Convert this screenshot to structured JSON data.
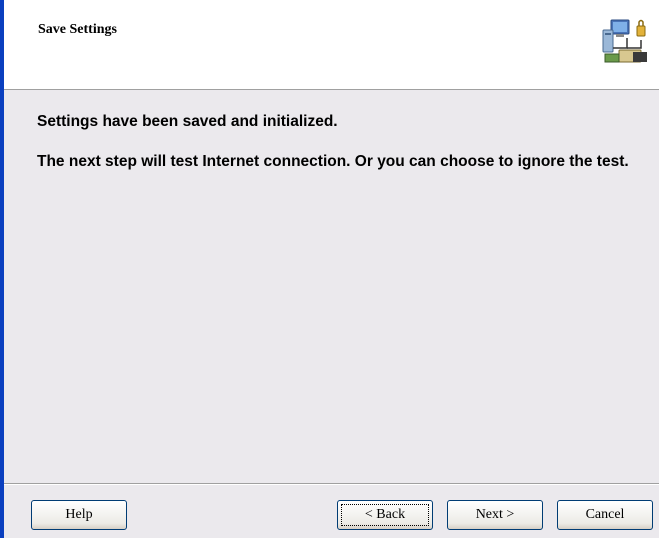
{
  "header": {
    "title": "Save Settings",
    "icon": "network-computers-icon"
  },
  "content": {
    "message_1": "Settings have been saved and initialized.",
    "message_2": "The next step will test Internet connection. Or you can choose to ignore the test."
  },
  "buttons": {
    "help": "Help",
    "back": "< Back",
    "next": "Next >",
    "cancel": "Cancel"
  },
  "colors": {
    "window_border": "#0a3fbf",
    "header_bg": "#ffffff",
    "body_bg": "#ebe9ed"
  }
}
